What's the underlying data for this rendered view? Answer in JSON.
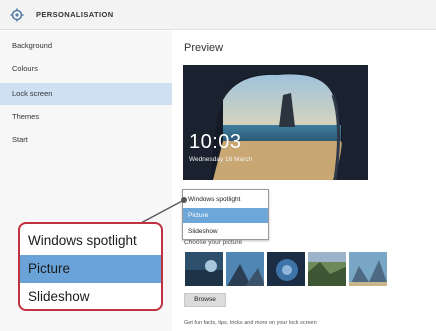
{
  "window": {
    "title": "PERSONALISATION"
  },
  "sidebar": {
    "items": [
      {
        "label": "Background"
      },
      {
        "label": "Colours"
      },
      {
        "label": "Lock screen"
      },
      {
        "label": "Themes"
      },
      {
        "label": "Start"
      }
    ],
    "selected": "Lock screen"
  },
  "main": {
    "preview_label": "Preview",
    "lock_time": "10:03",
    "lock_date": "Wednesday 16 March",
    "choose_label": "Choose your picture",
    "browse_label": "Browse",
    "hint": "Get fun facts, tips, tricks and more on your lock screen"
  },
  "background_dropdown": {
    "options": [
      "Windows spotlight",
      "Picture",
      "Slideshow"
    ],
    "selected": "Picture"
  },
  "callout": {
    "options": [
      "Windows spotlight",
      "Picture",
      "Slideshow"
    ],
    "selected": "Picture"
  },
  "colors": {
    "accent": "#6aa3d8",
    "callout_border": "#c0323f",
    "sidebar_selected": "#cfe0f3"
  }
}
